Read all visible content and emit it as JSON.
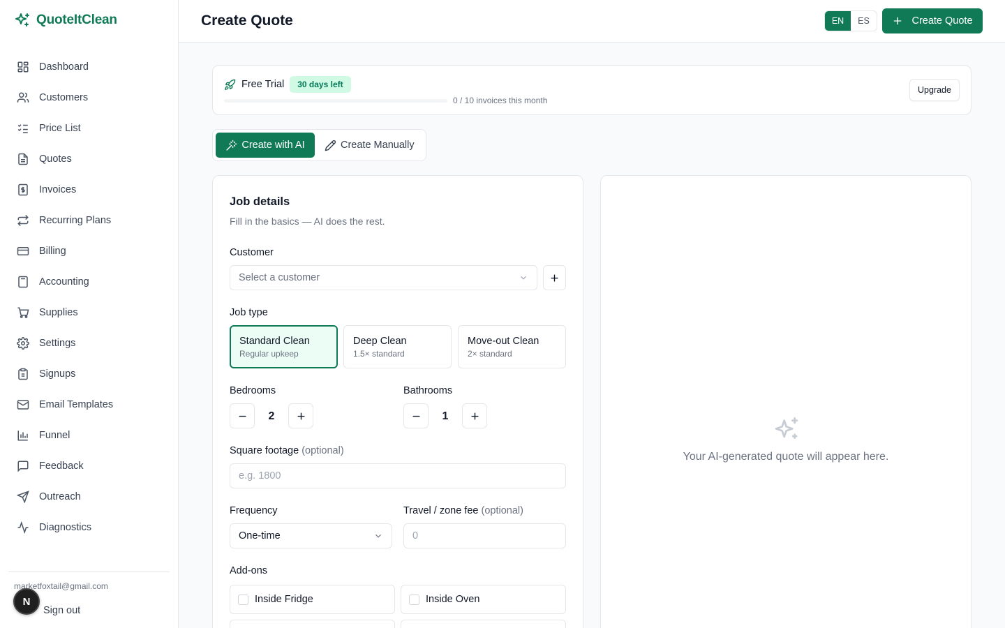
{
  "brand": {
    "name": "QuoteItClean",
    "accent": "#0f7a55"
  },
  "sidebar": {
    "items": [
      {
        "label": "Dashboard",
        "icon": "dashboard-icon"
      },
      {
        "label": "Customers",
        "icon": "users-icon"
      },
      {
        "label": "Price List",
        "icon": "list-checks-icon"
      },
      {
        "label": "Quotes",
        "icon": "file-text-icon"
      },
      {
        "label": "Invoices",
        "icon": "receipt-dollar-icon"
      },
      {
        "label": "Recurring Plans",
        "icon": "repeat-icon"
      },
      {
        "label": "Billing",
        "icon": "credit-card-icon"
      },
      {
        "label": "Accounting",
        "icon": "calculator-icon"
      },
      {
        "label": "Supplies",
        "icon": "cart-icon"
      },
      {
        "label": "Settings",
        "icon": "gear-icon"
      },
      {
        "label": "Signups",
        "icon": "clipboard-icon"
      },
      {
        "label": "Email Templates",
        "icon": "mail-icon"
      },
      {
        "label": "Funnel",
        "icon": "bar-chart-icon"
      },
      {
        "label": "Feedback",
        "icon": "message-icon"
      },
      {
        "label": "Outreach",
        "icon": "send-icon"
      },
      {
        "label": "Diagnostics",
        "icon": "activity-icon"
      }
    ],
    "user_email": "marketfoxtail@gmail.com",
    "sign_out": "Sign out",
    "avatar_letter": "N"
  },
  "header": {
    "title": "Create Quote",
    "languages": [
      "EN",
      "ES"
    ],
    "active_language": "EN",
    "create_button": "Create Quote"
  },
  "trial": {
    "label": "Free Trial",
    "days_left": "30 days left",
    "usage_text": "0 / 10 invoices this month",
    "usage_fraction": 0,
    "upgrade": "Upgrade"
  },
  "mode": {
    "ai": "Create with AI",
    "manual": "Create Manually",
    "active": "ai"
  },
  "form": {
    "title": "Job details",
    "subtitle": "Fill in the basics — AI does the rest.",
    "customer_label": "Customer",
    "customer_placeholder": "Select a customer",
    "job_type_label": "Job type",
    "job_types": [
      {
        "name": "Standard Clean",
        "desc": "Regular upkeep",
        "selected": true
      },
      {
        "name": "Deep Clean",
        "desc": "1.5× standard",
        "selected": false
      },
      {
        "name": "Move-out Clean",
        "desc": "2× standard",
        "selected": false
      }
    ],
    "bedrooms_label": "Bedrooms",
    "bedrooms": "2",
    "bathrooms_label": "Bathrooms",
    "bathrooms": "1",
    "sqft_label": "Square footage",
    "optional": "(optional)",
    "sqft_placeholder": "e.g. 1800",
    "frequency_label": "Frequency",
    "frequency_value": "One-time",
    "travel_label": "Travel / zone fee",
    "travel_placeholder": "0",
    "addons_label": "Add-ons",
    "addons": [
      {
        "label": "Inside Fridge",
        "checked": false
      },
      {
        "label": "Inside Oven",
        "checked": false
      }
    ]
  },
  "preview": {
    "empty_text": "Your AI-generated quote will appear here."
  }
}
